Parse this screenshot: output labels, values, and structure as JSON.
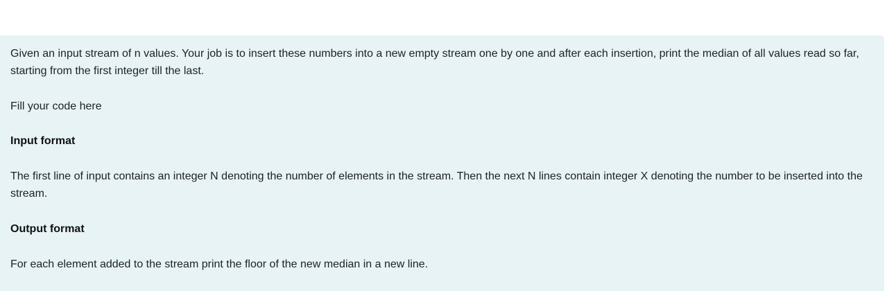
{
  "question": {
    "intro": "Given an input stream of n values. Your job is to insert these numbers into a new empty stream one by one and after each insertion, print the median of all values read so far, starting from the first integer till the last.",
    "fill_code_note": "Fill your code here",
    "input_heading": "Input format",
    "input_text": "The first line of input contains an integer N denoting the number of elements in the stream. Then the next N lines contain integer X denoting the number to be inserted into the stream.",
    "output_heading": "Output format",
    "output_text": "For each element added to the stream print the floor of the new median in a new line."
  },
  "colors": {
    "panel_background": "#e7f3f5",
    "text": "#1d2125",
    "page_background": "#ffffff"
  }
}
